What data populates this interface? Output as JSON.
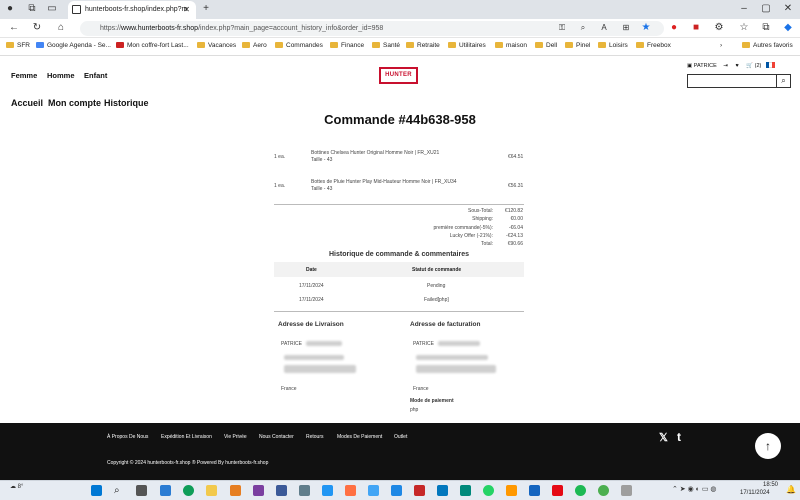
{
  "browser": {
    "tab_title": "hunterboots-fr.shop/index.php?m",
    "url_prefix": "https://",
    "url_host": "www.hunterboots-fr.shop",
    "url_path": "/index.php?main_page=account_history_info&order_id=958"
  },
  "bookmarks": [
    {
      "label": "SFR"
    },
    {
      "label": "Google Agenda - Se..."
    },
    {
      "label": "Mon coffre-fort Last..."
    },
    {
      "label": "Vacances"
    },
    {
      "label": "Aero"
    },
    {
      "label": "Commandes"
    },
    {
      "label": "Finance"
    },
    {
      "label": "Santé"
    },
    {
      "label": "Retraite"
    },
    {
      "label": "Utilitaires"
    },
    {
      "label": "maison"
    },
    {
      "label": "Dell"
    },
    {
      "label": "Pinel"
    },
    {
      "label": "Loisirs"
    },
    {
      "label": "Freebox"
    },
    {
      "label": "Autres favoris"
    }
  ],
  "site": {
    "nav": [
      "Femme",
      "Homme",
      "Enfant"
    ],
    "logo": "HUNTER",
    "account_name": "PATRICE",
    "cart_count": "(2)",
    "breadcrumb": [
      "Accueil",
      "Mon compte",
      "Historique"
    ],
    "page_title": "Commande #44b638-958"
  },
  "order": {
    "items": [
      {
        "qty": "1 ea.",
        "name": "Bottines Chelsea Hunter Original Homme Noir | FR_XU21",
        "size": "Taille - 43",
        "price": "€64.51"
      },
      {
        "qty": "1 ea.",
        "name": "Bottes de Pluie Hunter Play Mid-Hauteur Homme Noir | FR_XU34",
        "size": "Taille - 43",
        "price": "€56.31"
      }
    ],
    "totals": [
      {
        "label": "Sous-Total:",
        "value": "€120.82"
      },
      {
        "label": "Shipping:",
        "value": "€0.00"
      },
      {
        "label": "première commande(-5%):",
        "value": "-€6.04"
      },
      {
        "label": "Lucky Offer (-21%):",
        "value": "-€24.13"
      },
      {
        "label": "Total:",
        "value": "€90.66"
      }
    ],
    "history_title": "Historique de commande & commentaires",
    "history_headers": {
      "date": "Date",
      "status": "Statut de commande"
    },
    "history_rows": [
      {
        "date": "17/11/2024",
        "status": "Pending"
      },
      {
        "date": "17/11/2024",
        "status": "Failed[php]"
      }
    ],
    "delivery_title": "Adresse de Livraison",
    "billing_title": "Adresse de facturation",
    "delivery_name": "PATRICE",
    "billing_name": "PATRICE",
    "delivery_country": "France",
    "billing_country": "France",
    "payment_title": "Mode de paiement",
    "payment_method": "php"
  },
  "footer": {
    "links": [
      "À Propos De Nous",
      "Expédition Et Livraison",
      "Vie Privée",
      "Nous Contacter",
      "Retours",
      "Modes De Paiement",
      "Outlet"
    ],
    "copyright": "Copyright © 2024 hunterboots-fr.shop ® Powered By hunterboots-fr.shop"
  },
  "taskbar": {
    "temperature": "8°",
    "time": "18:50",
    "date": "17/11/2024"
  },
  "colors": {
    "brand_red": "#c8102e",
    "footer_bg": "#111111",
    "folder": "#e8b53a"
  }
}
